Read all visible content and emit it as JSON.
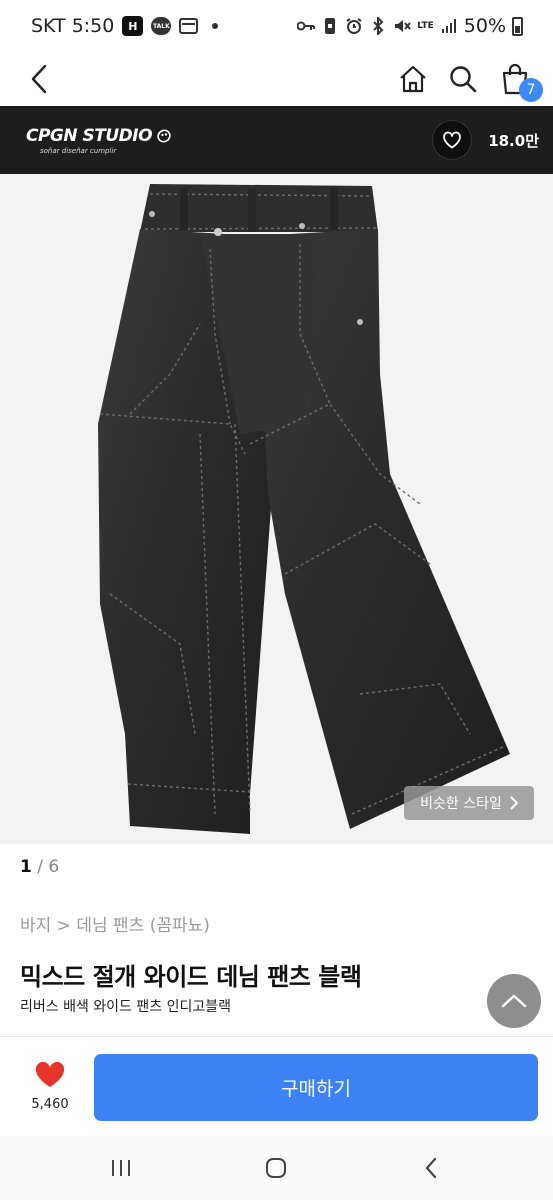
{
  "status_bar": {
    "carrier_time": "SKT 5:50",
    "h_badge": "H",
    "talk_badge": "TALK",
    "network": "LTE",
    "battery": "50%"
  },
  "header": {
    "icons": [
      "back-icon",
      "home-icon",
      "search-icon",
      "cart-icon"
    ],
    "cart_count": "7"
  },
  "shop": {
    "name": "CPGN STUDIO",
    "tagline": "soñar diseñar cumplir",
    "like_count": "18.0만"
  },
  "product": {
    "similar_style": "비슷한 스타일",
    "page_current": "1",
    "page_total": "/ 6",
    "breadcrumb": "바지 > 데님 팬츠 (꼼파뇨)",
    "title": "믹스드 절개 와이드 데님 팬츠 블랙",
    "subtitle": "리버스 배색 와이드 팬츠 인디고블랙"
  },
  "action_bar": {
    "wish_count": "5,460",
    "buy_label": "구매하기"
  },
  "colors": {
    "accent": "#3d82f4",
    "heart": "#e8332a",
    "banner": "#1d1d1d"
  }
}
